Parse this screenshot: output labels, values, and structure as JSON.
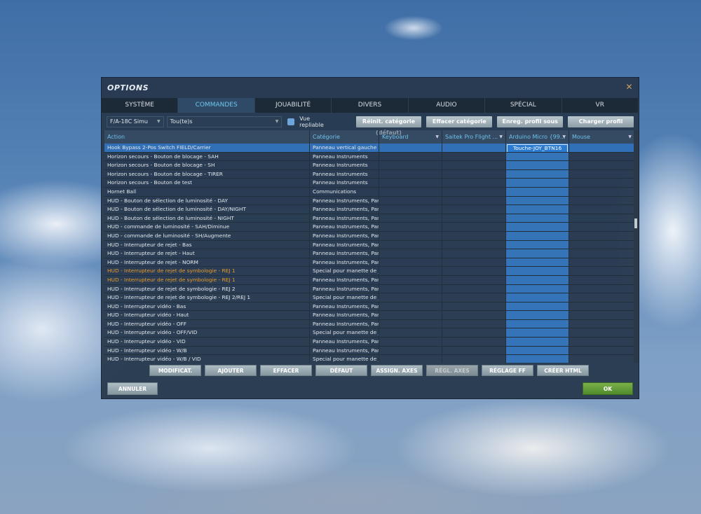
{
  "window": {
    "title": "OPTIONS",
    "close": "✕"
  },
  "tabs": [
    "SYSTÈME",
    "COMMANDES",
    "JOUABILITÉ",
    "DIVERS",
    "AUDIO",
    "SPÉCIAL",
    "VR"
  ],
  "toolbar": {
    "aircraft": "F/A-18C Simu",
    "filter": "Tou(te)s",
    "collapsible_label": "Vue repliable",
    "collapsible_checked": true,
    "buttons": [
      "Réinit. catégorie (défaut)",
      "Effacer catégorie",
      "Enreg. profil sous",
      "Charger profil"
    ]
  },
  "columns": [
    "Action",
    "Catégorie",
    "Keyboard",
    "Saitek Pro Flight ...",
    "Arduino Micro {99...",
    "Mouse"
  ],
  "rows": [
    {
      "action": "Hook Bypass 2-Pos Switch FIELD/Carrier",
      "category": "Panneau vertical gauche",
      "arduino": "Touche-JOY_BTN16",
      "selected": true
    },
    {
      "action": "Horizon secours - Bouton de blocage - SAH",
      "category": "Panneau Instruments"
    },
    {
      "action": "Horizon secours - Bouton de blocage - SH",
      "category": "Panneau Instruments"
    },
    {
      "action": "Horizon secours - Bouton de blocage - TIRER",
      "category": "Panneau Instruments"
    },
    {
      "action": "Horizon secours - Bouton de test",
      "category": "Panneau Instruments"
    },
    {
      "action": "Hornet Ball",
      "category": "Communications"
    },
    {
      "action": "HUD - Bouton de sélection de luminosité - DAY",
      "category": "Panneau Instruments, Pan"
    },
    {
      "action": "HUD - Bouton de sélection de luminosité - DAY/NIGHT",
      "category": "Panneau Instruments, Pan"
    },
    {
      "action": "HUD - Bouton de sélection de luminosité - NIGHT",
      "category": "Panneau Instruments, Pan"
    },
    {
      "action": "HUD - commande de luminosité - SAH/Diminue",
      "category": "Panneau Instruments, Pan"
    },
    {
      "action": "HUD - commande de luminosité - SH/Augmente",
      "category": "Panneau Instruments, Pan"
    },
    {
      "action": "HUD - Interrupteur de rejet - Bas",
      "category": "Panneau Instruments, Pan"
    },
    {
      "action": "HUD - Interrupteur de rejet - Haut",
      "category": "Panneau Instruments, Pan"
    },
    {
      "action": "HUD - Interrupteur de rejet - NORM",
      "category": "Panneau Instruments, Pan"
    },
    {
      "action": "HUD - Interrupteur de rejet de symbologie - REJ 1",
      "category": "Special pour manette de je",
      "conflict": true
    },
    {
      "action": "HUD - Interrupteur de rejet de symbologie - REJ 1",
      "category": "Panneau Instruments, Pan",
      "conflict": true
    },
    {
      "action": "HUD - Interrupteur de rejet de symbologie - REJ 2",
      "category": "Panneau Instruments, Pan"
    },
    {
      "action": "HUD - Interrupteur de rejet de symbologie - REJ 2/REJ 1",
      "category": "Special pour manette de je"
    },
    {
      "action": "HUD - Interrupteur vidéo - Bas",
      "category": "Panneau Instruments, Pan"
    },
    {
      "action": "HUD - Interrupteur vidéo - Haut",
      "category": "Panneau Instruments, Pan"
    },
    {
      "action": "HUD - Interrupteur vidéo - OFF",
      "category": "Panneau Instruments, Pan"
    },
    {
      "action": "HUD - Interrupteur vidéo - OFF/VID",
      "category": "Special pour manette de je"
    },
    {
      "action": "HUD - Interrupteur vidéo - VID",
      "category": "Panneau Instruments, Pan"
    },
    {
      "action": "HUD - Interrupteur vidéo - W/B",
      "category": "Panneau Instruments, Pan"
    },
    {
      "action": "HUD - Interrupteur vidéo - W/B / VID",
      "category": "Special pour manette de je"
    }
  ],
  "actions": [
    {
      "label": "MODIFICAT."
    },
    {
      "label": "AJOUTER"
    },
    {
      "label": "EFFACER"
    },
    {
      "label": "DÉFAUT"
    },
    {
      "label": "ASSIGN. AXES"
    },
    {
      "label": "RÉGL. AXES",
      "disabled": true
    },
    {
      "label": "RÉGLAGE FF"
    },
    {
      "label": "CRÉER HTML"
    }
  ],
  "footer": {
    "cancel": "ANNULER",
    "ok": "OK"
  }
}
